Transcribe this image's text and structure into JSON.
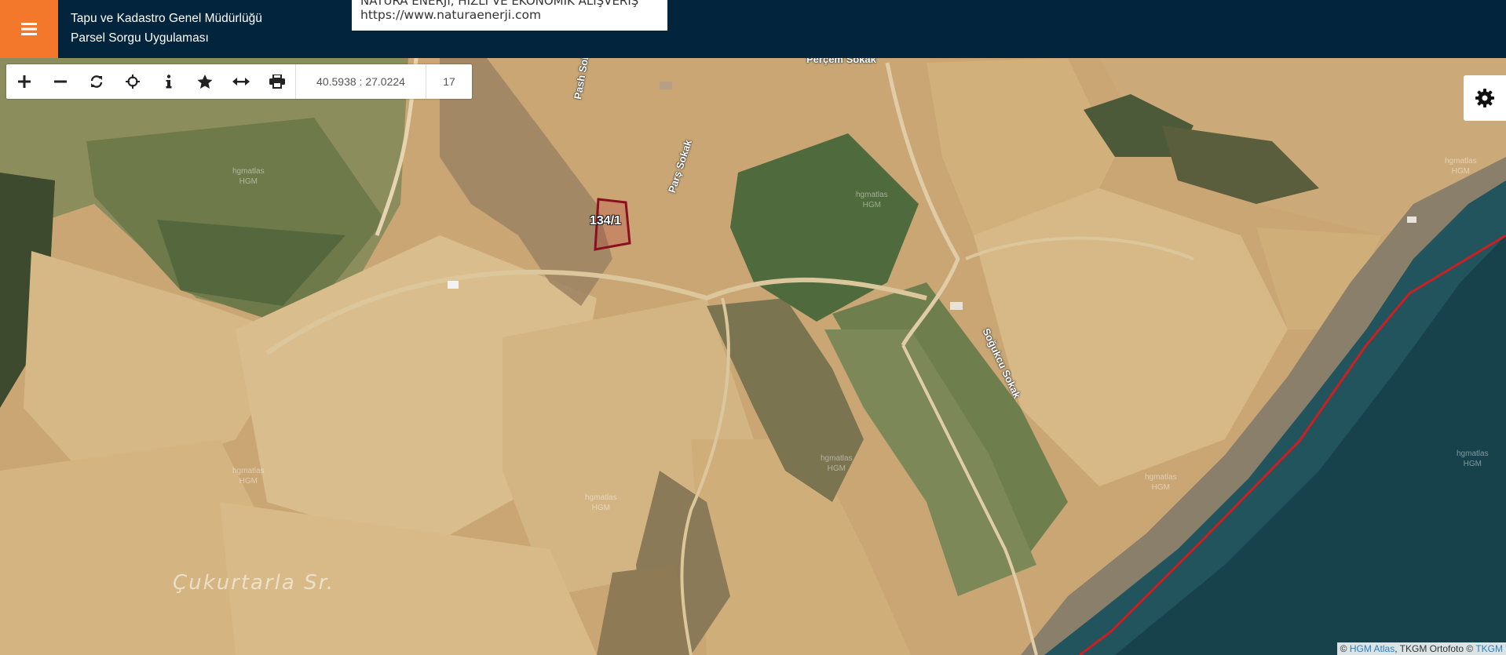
{
  "header": {
    "menu_icon": "hamburger-menu-icon",
    "title_line1": "Tapu ve Kadastro Genel Müdürlüğü",
    "title_line2": "Parsel Sorgu Uygulaması",
    "ad_line1": "NATURA ENERJİ, HIZLI VE EKONOMİK ALIŞVERİŞ",
    "ad_line2": "https://www.naturaenerji.com"
  },
  "toolbar": {
    "tools": [
      {
        "icon": "zoom-in-icon"
      },
      {
        "icon": "zoom-out-icon"
      },
      {
        "icon": "refresh-icon"
      },
      {
        "icon": "locate-icon"
      },
      {
        "icon": "info-icon"
      },
      {
        "icon": "favorite-star-icon"
      },
      {
        "icon": "measure-icon"
      },
      {
        "icon": "print-icon"
      }
    ],
    "coordinates": "40.5938 : 27.0224",
    "zoom_level": "17"
  },
  "settings": {
    "icon": "gear-icon"
  },
  "map": {
    "parcel_label": "134/1",
    "streets": [
      "Perçem Sokak",
      "Pash Sokak",
      "Parş Sokak",
      "Soğukcu Sokak"
    ],
    "place_name": "Çukurtarla Sr.",
    "watermark_line1": "hgmatlas",
    "watermark_line2": "HGM",
    "colors": {
      "parcel": "#8b0f1e",
      "boundary": "#cc1f1f",
      "header": "#02243c",
      "menu": "#f3782b"
    }
  },
  "attribution": {
    "prefix": "©",
    "hgm_link": "HGM Atlas",
    "middle": ", TKGM Ortofoto ©",
    "tkgm_link": "TKGM"
  }
}
